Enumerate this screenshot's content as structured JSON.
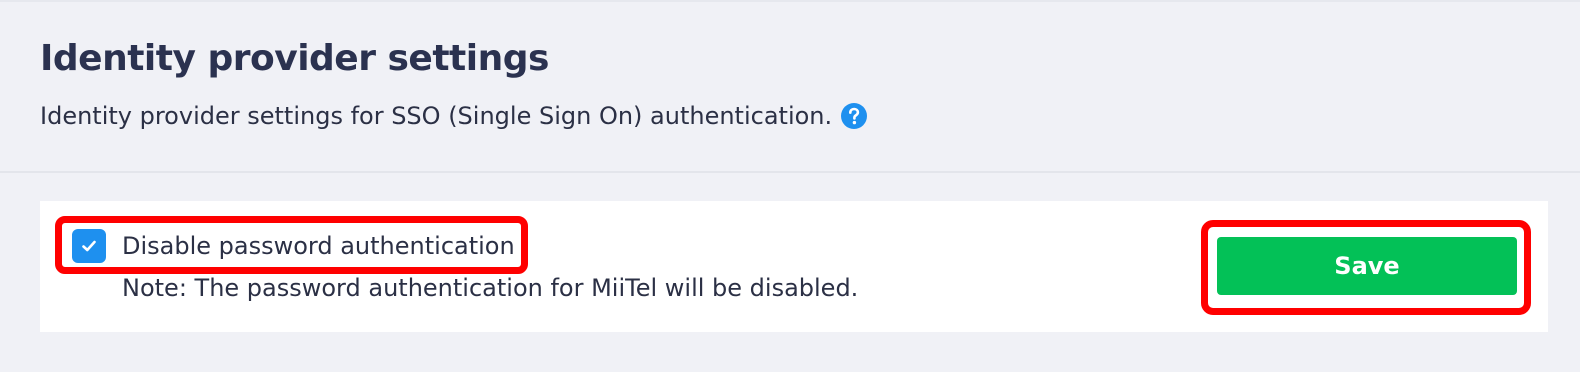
{
  "header": {
    "title": "Identity provider settings",
    "subtitle": "Identity provider settings for SSO (Single Sign On) authentication.",
    "help_icon": "question-circle-icon"
  },
  "settings": {
    "disable_password": {
      "label": "Disable password authentication",
      "checked": true,
      "note": "Note: The password authentication for MiiTel will be disabled."
    },
    "save_label": "Save"
  },
  "colors": {
    "accent_blue": "#1e90ef",
    "save_green": "#03c157",
    "highlight_red": "#ff0000"
  }
}
